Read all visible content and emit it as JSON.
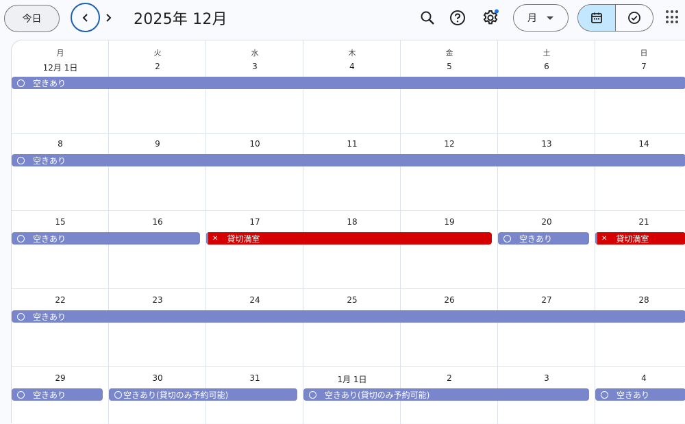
{
  "toolbar": {
    "today_label": "今日",
    "month_title": "2025年 12月",
    "view_label": "月",
    "colors": {
      "accent_ring": "#1a5fb4",
      "toggle_on": "#c2e7ff",
      "badge": "#1a73e8"
    }
  },
  "weekdays": [
    "月",
    "火",
    "水",
    "木",
    "金",
    "土",
    "日"
  ],
  "weeks": [
    {
      "days": [
        "12月 1日",
        "2",
        "3",
        "4",
        "5",
        "6",
        "7"
      ]
    },
    {
      "days": [
        "8",
        "9",
        "10",
        "11",
        "12",
        "13",
        "14"
      ]
    },
    {
      "days": [
        "15",
        "16",
        "17",
        "18",
        "19",
        "20",
        "21"
      ]
    },
    {
      "days": [
        "22",
        "23",
        "24",
        "25",
        "26",
        "27",
        "28"
      ]
    },
    {
      "days": [
        "29",
        "30",
        "31",
        "1月 1日",
        "2",
        "3",
        "4"
      ]
    }
  ],
  "events": {
    "w1_avail": "空きあり",
    "w2_avail": "空きあり",
    "w3_avail_a": "空きあり",
    "w3_full_a": "貸切満室",
    "w3_avail_b": "空きあり",
    "w3_full_b": "貸切満室",
    "w4_avail": "空きあり",
    "w5_avail_a": "空きあり",
    "w5_partial_a": "空きあり(貸切のみ予約可能)",
    "w5_partial_b": "空きあり(貸切のみ予約可能)",
    "w5_avail_b": "空きあり"
  },
  "event_colors": {
    "available": "#7986cb",
    "full": "#d50000"
  }
}
